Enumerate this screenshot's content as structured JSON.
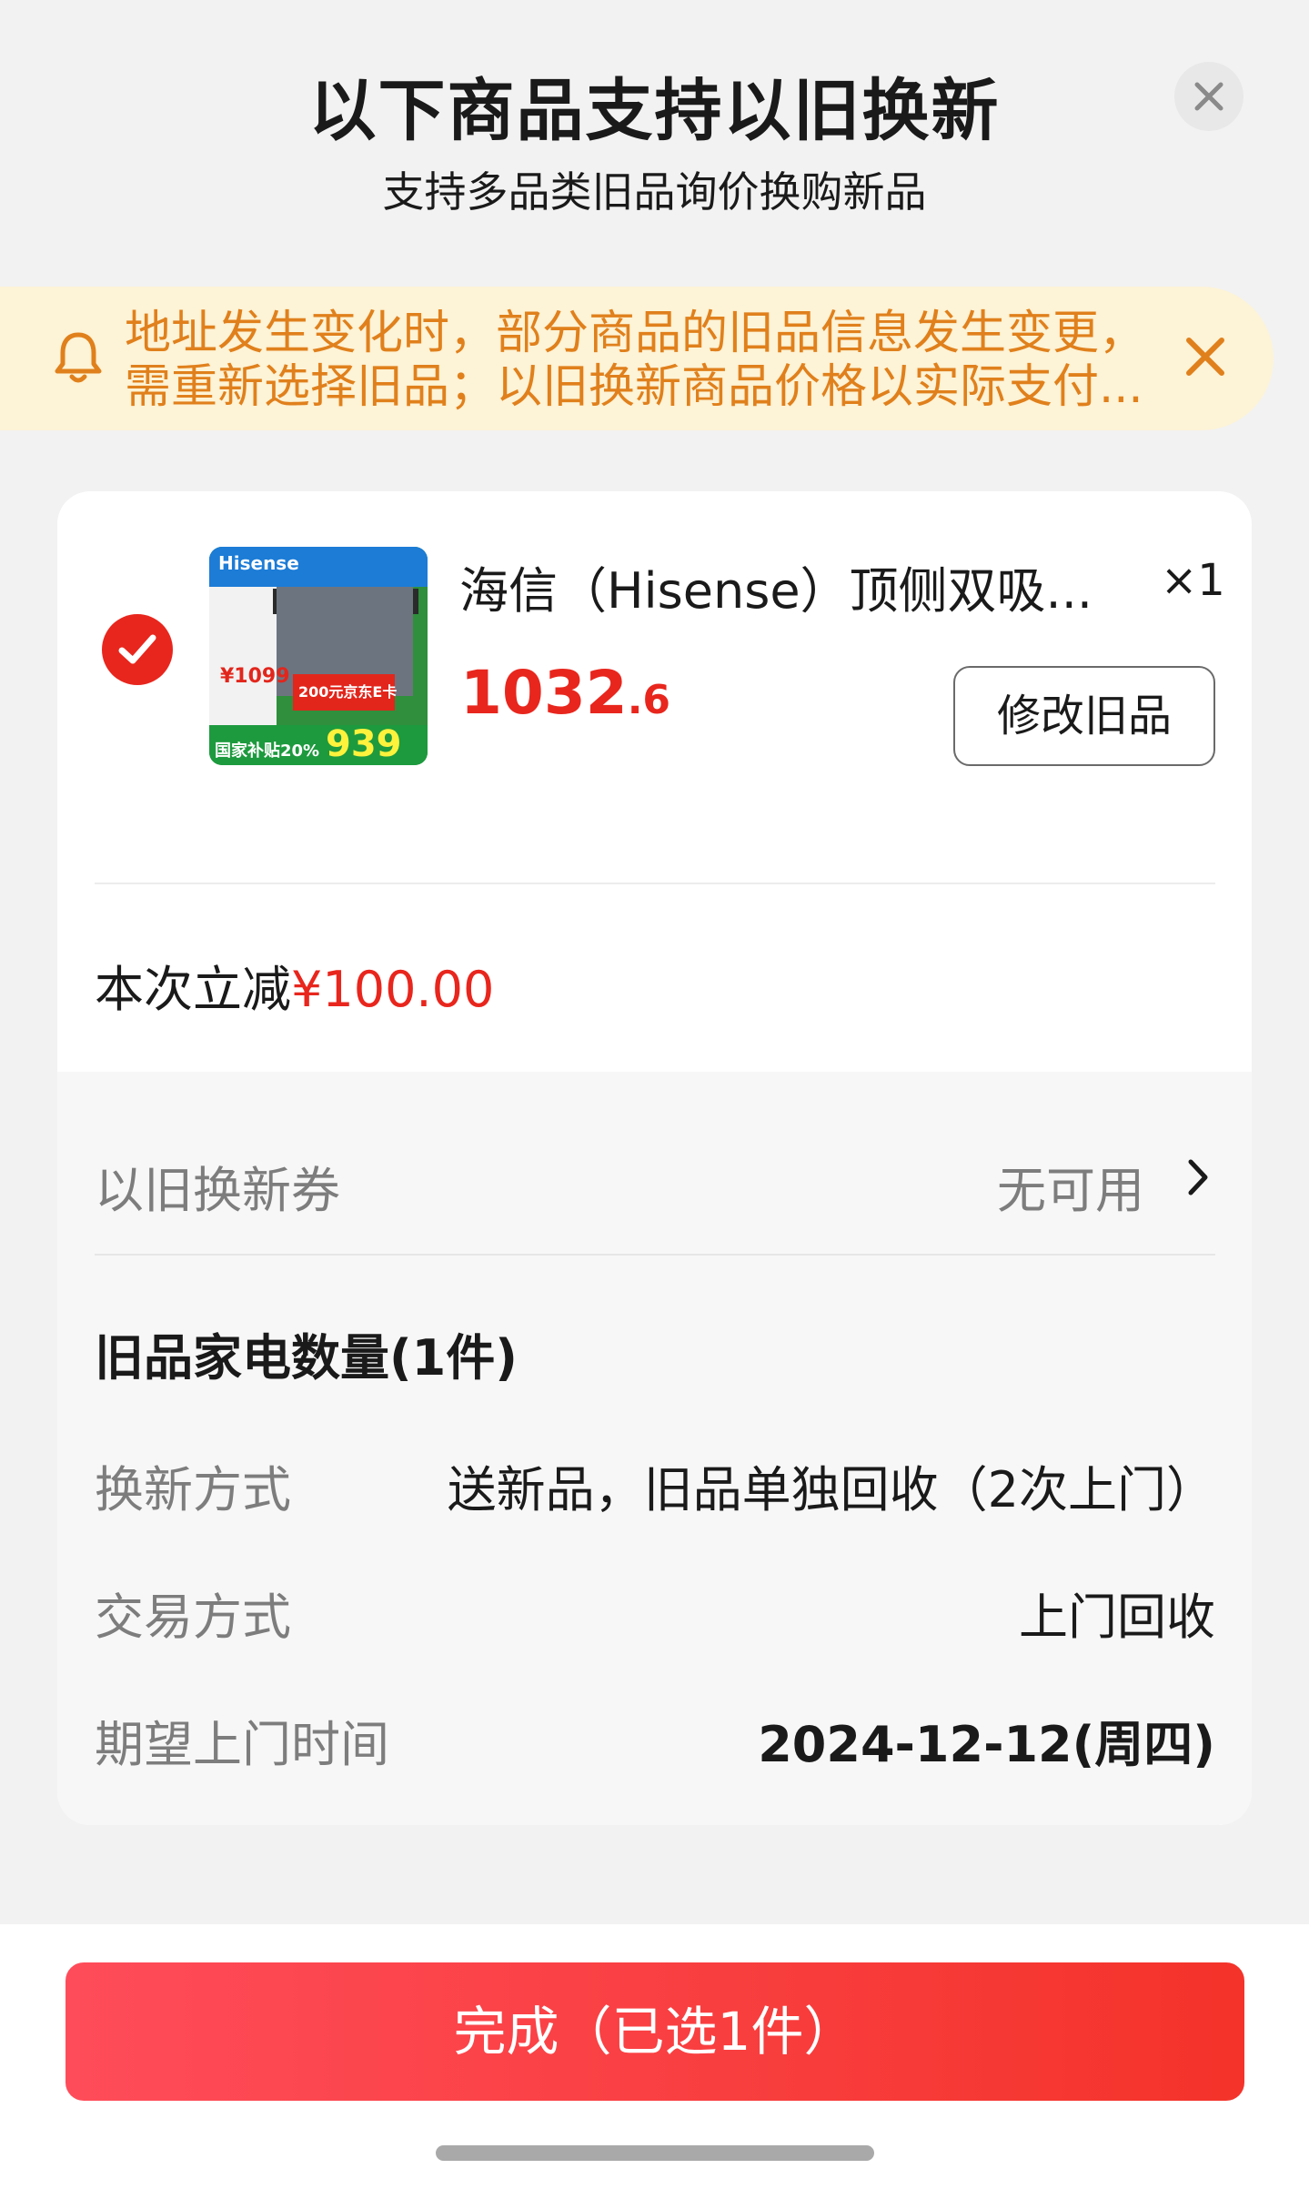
{
  "header": {
    "title": "以下商品支持以旧换新",
    "subtitle": "支持多品类旧品询价换购新品"
  },
  "notice": {
    "line1": "地址发生变化时，部分商品的旧品信息发生变更，",
    "line2": "需重新选择旧品；以旧换新商品价格以实际支付...",
    "icon": "bell-icon",
    "color": "#e0801c",
    "background": "#fdf3d6"
  },
  "product": {
    "name": "海信（Hisense）顶侧双吸...",
    "quantity": "×1",
    "price_int": "1032",
    "price_dec": ".6",
    "modify_label": "修改旧品",
    "selected": true,
    "thumbnail": {
      "brand": "Hisense",
      "price_badge": "¥1099",
      "tag": "200元京东E卡",
      "big_price": "939",
      "subsidy": "国家补贴20%"
    }
  },
  "saving": {
    "label": "本次立减",
    "amount": "¥100.00"
  },
  "coupon": {
    "label": "以旧换新券",
    "value": "无可用"
  },
  "old_items": {
    "title": "旧品家电数量(1件)",
    "rows": [
      {
        "label": "换新方式",
        "value": "送新品，旧品单独回收（2次上门）"
      },
      {
        "label": "交易方式",
        "value": "上门回收"
      },
      {
        "label": "期望上门时间",
        "value": "2024-12-12(周四)"
      }
    ]
  },
  "footer": {
    "done_label": "完成（已选1件）"
  },
  "colors": {
    "accent": "#e8261d",
    "button_gradient_start": "#ff4c5a",
    "button_gradient_end": "#f4332a"
  }
}
